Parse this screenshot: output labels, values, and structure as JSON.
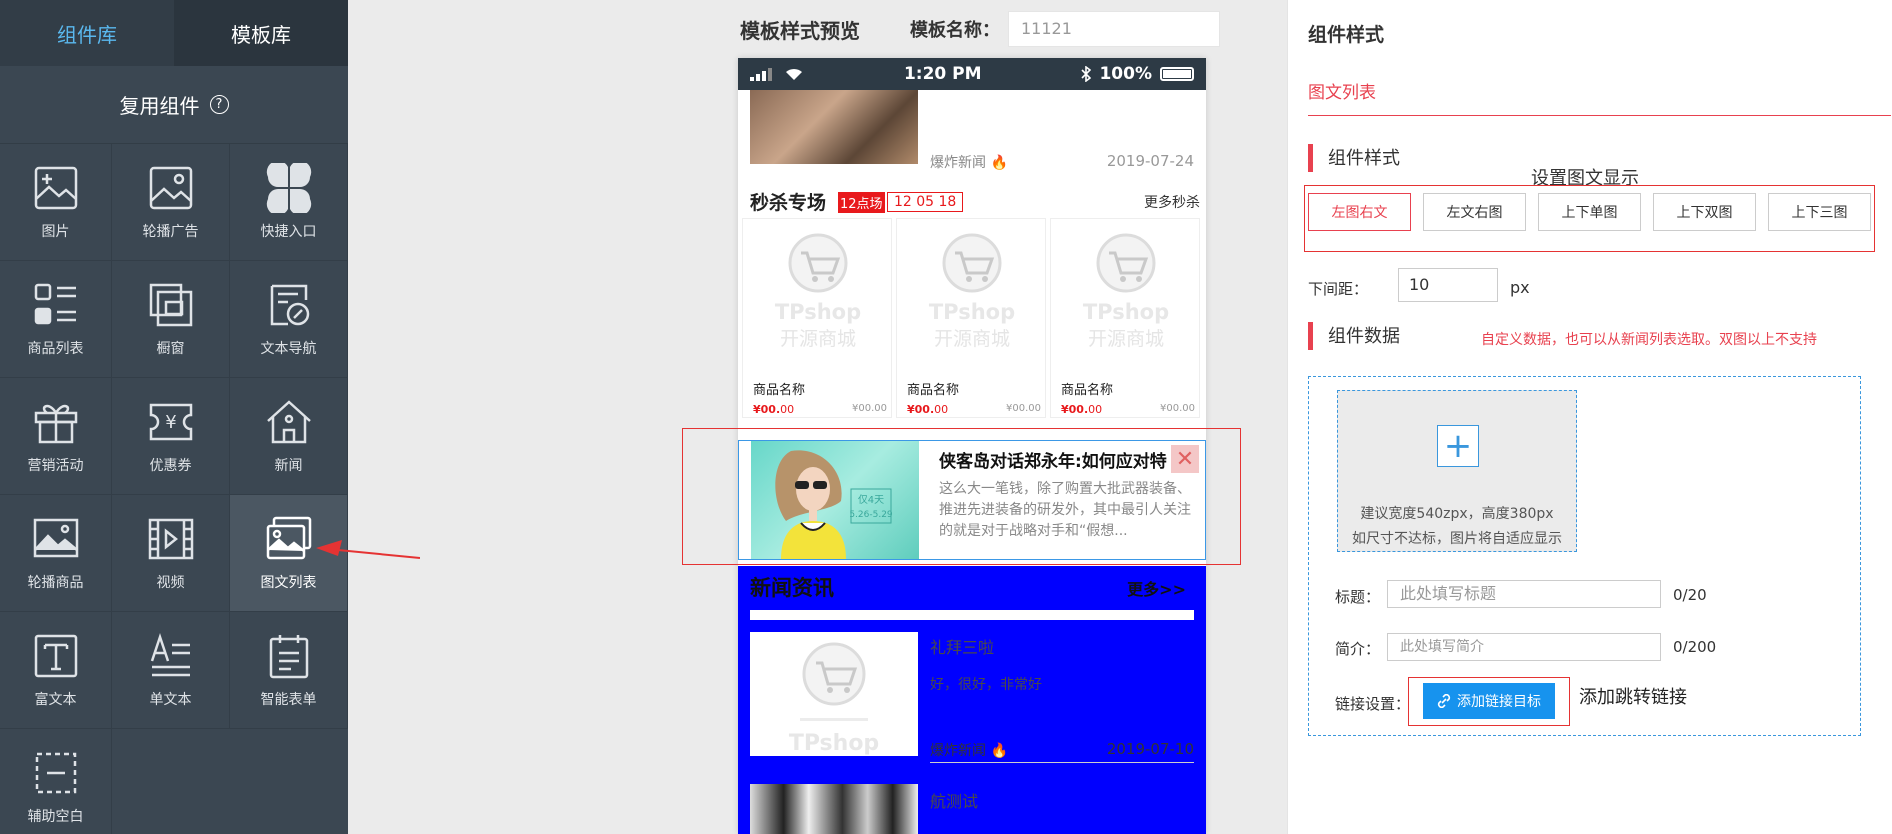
{
  "library": {
    "tab_components": "组件库",
    "tab_templates": "模板库",
    "reuse_title": "复用组件",
    "help_glyph": "?",
    "components": [
      {
        "label": "图片",
        "icon": "image-add-icon"
      },
      {
        "label": "轮播广告",
        "icon": "carousel-ad-icon"
      },
      {
        "label": "快捷入口",
        "icon": "quick-entry-icon"
      },
      {
        "label": "商品列表",
        "icon": "product-list-icon"
      },
      {
        "label": "橱窗",
        "icon": "showcase-icon"
      },
      {
        "label": "文本导航",
        "icon": "text-nav-icon"
      },
      {
        "label": "营销活动",
        "icon": "gift-icon"
      },
      {
        "label": "优惠券",
        "icon": "coupon-icon"
      },
      {
        "label": "新闻",
        "icon": "home-icon"
      },
      {
        "label": "轮播商品",
        "icon": "carousel-product-icon"
      },
      {
        "label": "视频",
        "icon": "video-icon"
      },
      {
        "label": "图文列表",
        "icon": "image-text-list-icon"
      },
      {
        "label": "富文本",
        "icon": "rich-text-icon"
      },
      {
        "label": "单文本",
        "icon": "single-text-icon"
      },
      {
        "label": "智能表单",
        "icon": "smart-form-icon"
      },
      {
        "label": "辅助空白",
        "icon": "blank-space-icon"
      }
    ]
  },
  "preview": {
    "title": "模板样式预览",
    "name_label": "模板名称：",
    "name_value": "11121",
    "status": {
      "time": "1:20 PM",
      "battery": "100%"
    },
    "top_news": {
      "source": "爆炸新闻",
      "date": "2019-07-24"
    },
    "seckill": {
      "title": "秒杀专场",
      "badge": "12点场",
      "timer": "12 05 18",
      "more": "更多秒杀"
    },
    "goods": [
      {
        "brand": "TPshop",
        "sub": "开源商城",
        "name": "商品名称",
        "price_a": "¥00.",
        "price_b": "00",
        "old": "¥00.00"
      },
      {
        "brand": "TPshop",
        "sub": "开源商城",
        "name": "商品名称",
        "price_a": "¥00.",
        "price_b": "00",
        "old": "¥00.00"
      },
      {
        "brand": "TPshop",
        "sub": "开源商城",
        "name": "商品名称",
        "price_a": "¥00.",
        "price_b": "00",
        "old": "¥00.00"
      }
    ],
    "selected_item": {
      "title": "侠客岛对话郑永年:如何应对特",
      "desc": "这么大一笔钱，除了购置大批武器装备、推进先进装备的研发外，其中最引人关注的就是对于战略对手和“假想...",
      "img_tag1": "仅4天",
      "img_tag2": "5.26-5.29",
      "close": "✕"
    },
    "news_block": {
      "title": "新闻资讯",
      "more": "更多>>",
      "item1": {
        "brand": "TPshop",
        "title": "礼拜三啦",
        "desc": "好，很好，非常好",
        "source": "爆炸新闻",
        "date": "2019-07-10"
      },
      "item2": {
        "title": "航测试"
      }
    }
  },
  "panel": {
    "title": "组件样式",
    "component_name": "图文列表",
    "style_section": "组件样式",
    "style_hint": "设置图文显示",
    "style_options": [
      "左图右文",
      "左文右图",
      "上下单图",
      "上下双图",
      "上下三图"
    ],
    "spacing_label": "下间距：",
    "spacing_value": "10",
    "spacing_unit": "px",
    "data_section": "组件数据",
    "data_hint": "自定义数据，也可以从新闻列表选取。双图以上不支持",
    "upload_plus": "+",
    "upload_hint1": "建议宽度540zpx，高度380px",
    "upload_hint2": "如尺寸不达标，图片将自适应显示",
    "title_label": "标题：",
    "title_placeholder": "此处填写标题",
    "title_count": "0/20",
    "desc_label": "简介：",
    "desc_placeholder": "此处填写简介",
    "desc_count": "0/200",
    "link_label": "链接设置：",
    "link_button": "添加链接目标",
    "link_hint": "添加跳转链接"
  },
  "colors": {
    "accent_red": "#e8414f",
    "selection_blue": "#1793ee",
    "news_block_bg": "#0000ff",
    "sidebar_bg": "#3b4752"
  }
}
